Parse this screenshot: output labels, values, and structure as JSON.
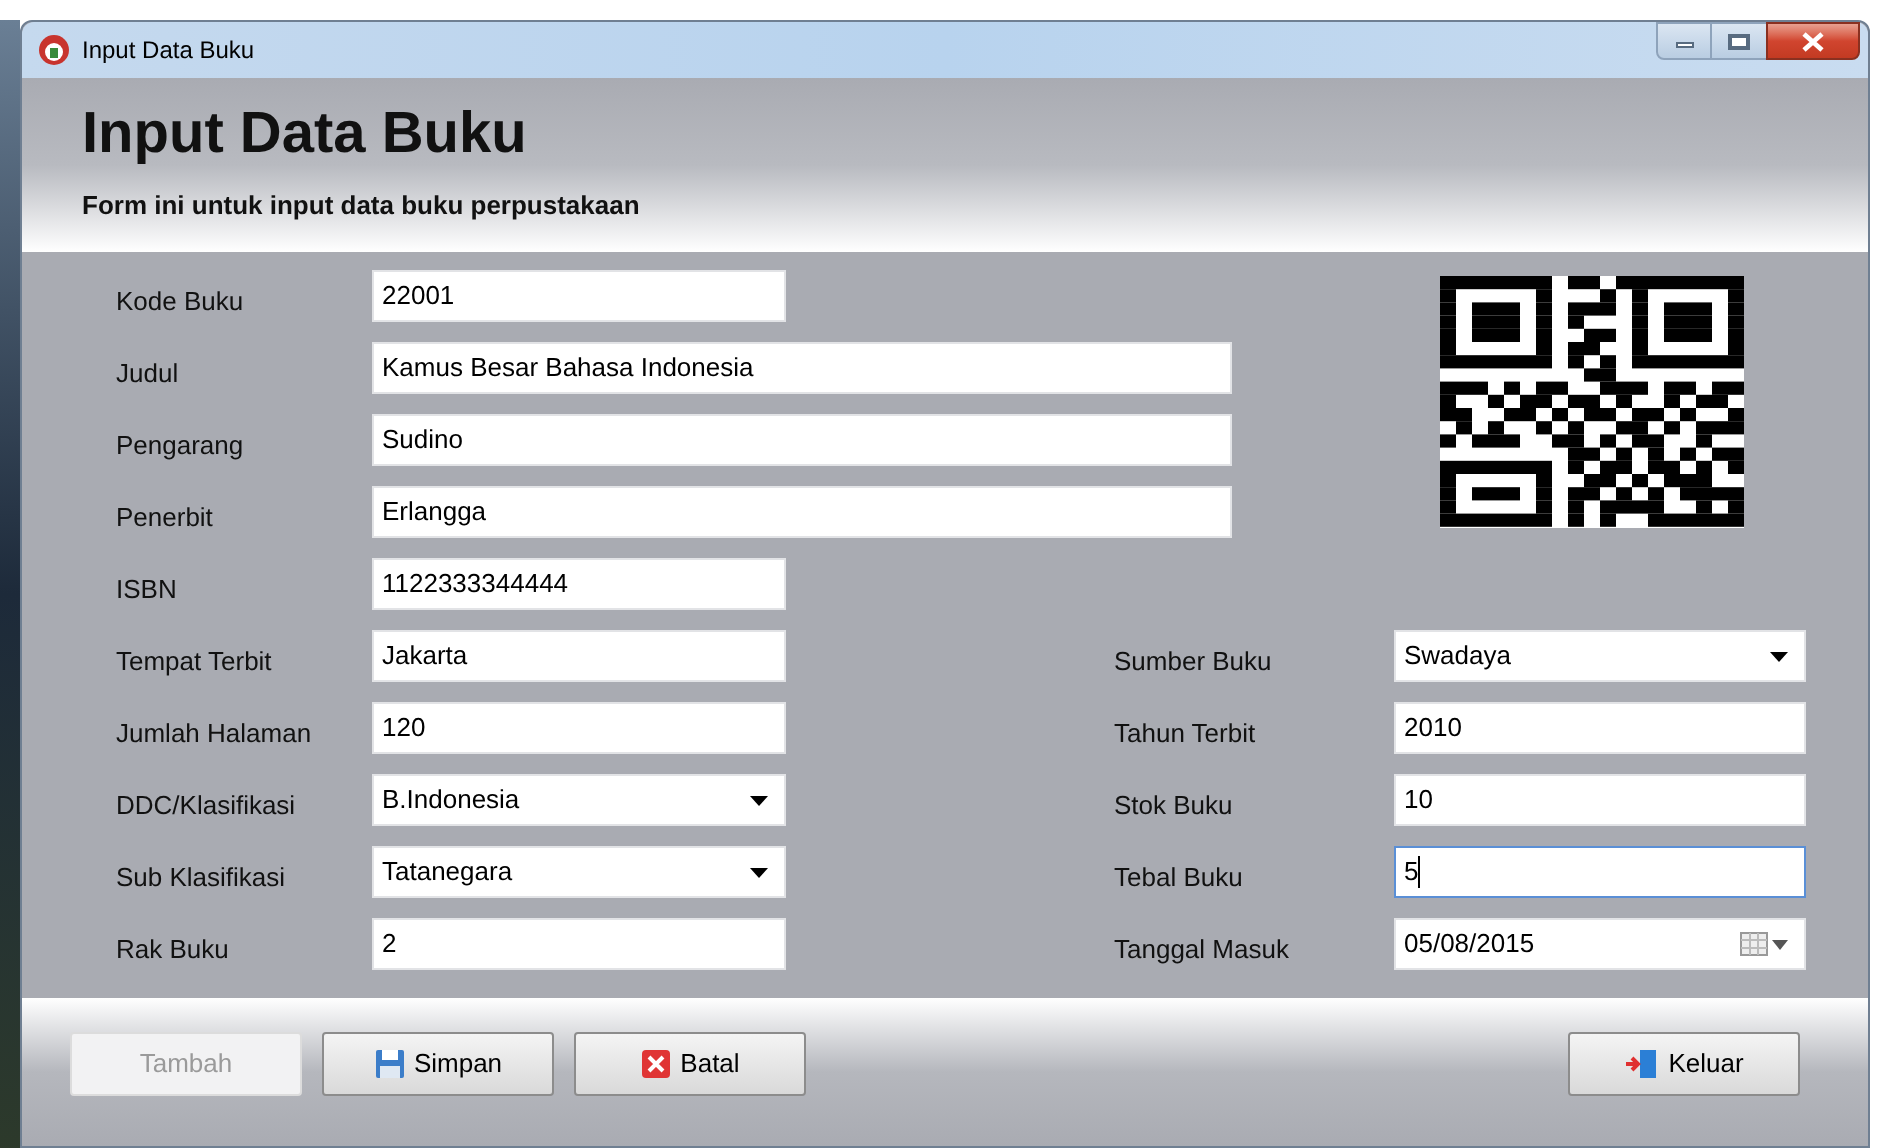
{
  "window": {
    "title": "Input Data Buku"
  },
  "header": {
    "title": "Input Data Buku",
    "subtitle": "Form ini untuk input data buku perpustakaan"
  },
  "top_fields": [
    {
      "label": "Kode Buku",
      "kind": "text",
      "value": "22001",
      "wide": false,
      "focused": false
    },
    {
      "label": "Judul",
      "kind": "text",
      "value": "Kamus Besar Bahasa Indonesia",
      "wide": true,
      "focused": false
    },
    {
      "label": "Pengarang",
      "kind": "text",
      "value": "Sudino",
      "wide": true,
      "focused": false
    },
    {
      "label": "Penerbit",
      "kind": "text",
      "value": "Erlangga",
      "wide": true,
      "focused": false
    },
    {
      "label": "ISBN",
      "kind": "text",
      "value": "1122333344444",
      "wide": false,
      "focused": false
    }
  ],
  "left_fields": [
    {
      "label": "Tempat Terbit",
      "kind": "text",
      "value": "Jakarta",
      "focused": false
    },
    {
      "label": "Jumlah Halaman",
      "kind": "text",
      "value": "120",
      "focused": false
    },
    {
      "label": "DDC/Klasifikasi",
      "kind": "combo",
      "value": "B.Indonesia",
      "focused": false
    },
    {
      "label": "Sub Klasifikasi",
      "kind": "combo",
      "value": "Tatanegara",
      "focused": false
    },
    {
      "label": "Rak Buku",
      "kind": "text",
      "value": "2",
      "focused": false
    }
  ],
  "right_fields": [
    {
      "label": "Sumber Buku",
      "kind": "combo",
      "value": "Swadaya",
      "focused": false
    },
    {
      "label": "Tahun Terbit",
      "kind": "text",
      "value": "2010",
      "focused": false
    },
    {
      "label": "Stok Buku",
      "kind": "text",
      "value": "10",
      "focused": false
    },
    {
      "label": "Tebal Buku",
      "kind": "text",
      "value": "5",
      "focused": true
    },
    {
      "label": "Tanggal Masuk",
      "kind": "date",
      "value": "05/08/2015",
      "focused": false
    }
  ],
  "buttons": [
    {
      "label": "Tambah",
      "kind": "add",
      "disabled": true
    },
    {
      "label": "Simpan",
      "kind": "save",
      "disabled": false
    },
    {
      "label": "Batal",
      "kind": "cancel",
      "disabled": false
    },
    {
      "label": "Keluar",
      "kind": "exit",
      "disabled": false
    }
  ]
}
